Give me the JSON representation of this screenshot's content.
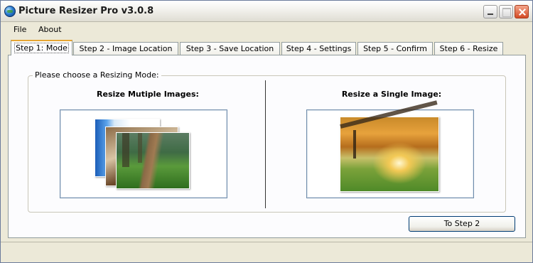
{
  "window": {
    "title": "Picture Resizer Pro v3.0.8",
    "controls": [
      "minimize",
      "maximize",
      "close"
    ],
    "icon": "globe-icon"
  },
  "menu": {
    "items": [
      {
        "label": "File"
      },
      {
        "label": "About"
      }
    ]
  },
  "tabs": [
    {
      "label": "Step 1: Mode",
      "active": true
    },
    {
      "label": "Step 2 - Image Location"
    },
    {
      "label": "Step 3 - Save Location"
    },
    {
      "label": "Step 4 - Settings"
    },
    {
      "label": "Step 5 - Confirm"
    },
    {
      "label": "Step 6 - Resize"
    }
  ],
  "panel": {
    "group_label": "Please choose a Resizing Mode:",
    "multi": {
      "heading": "Resize Mutiple Images:"
    },
    "single": {
      "heading": "Resize a Single Image:"
    },
    "next_button": "To Step 2"
  },
  "colors": {
    "active_tab_accent": "#e6a533",
    "button_border": "#003c74"
  }
}
